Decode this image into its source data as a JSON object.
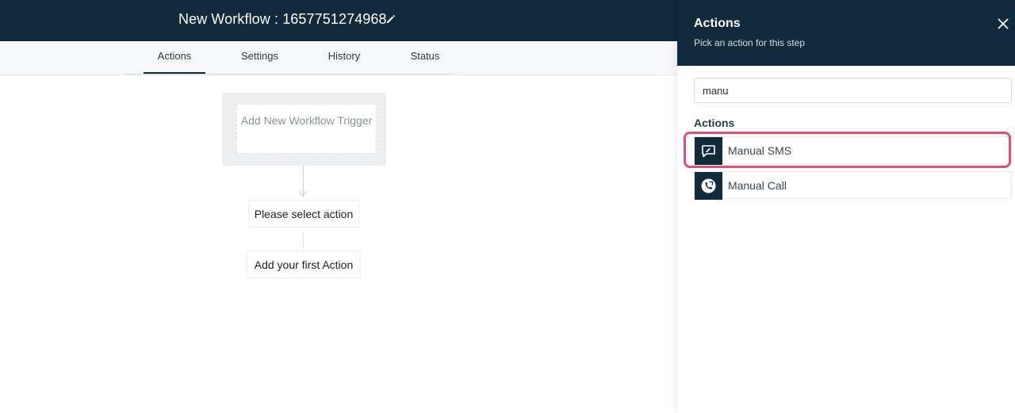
{
  "header": {
    "title": "New Workflow : 1657751274968"
  },
  "tabs": [
    {
      "label": "Actions",
      "active": true
    },
    {
      "label": "Settings"
    },
    {
      "label": "History"
    },
    {
      "label": "Status"
    }
  ],
  "canvas": {
    "trigger": "Add New Workflow Trigger",
    "select_action": "Please select action",
    "first_action": "Add your first Action"
  },
  "panel": {
    "title": "Actions",
    "subtitle": "Pick an action for this step",
    "search_value": "manu",
    "section_label": "Actions",
    "items": [
      {
        "label": "Manual SMS",
        "icon": "sms-edit-icon"
      },
      {
        "label": "Manual Call",
        "icon": "phone-call-icon"
      }
    ]
  },
  "colors": {
    "header": "#112b3c",
    "highlight": "#e05074"
  }
}
